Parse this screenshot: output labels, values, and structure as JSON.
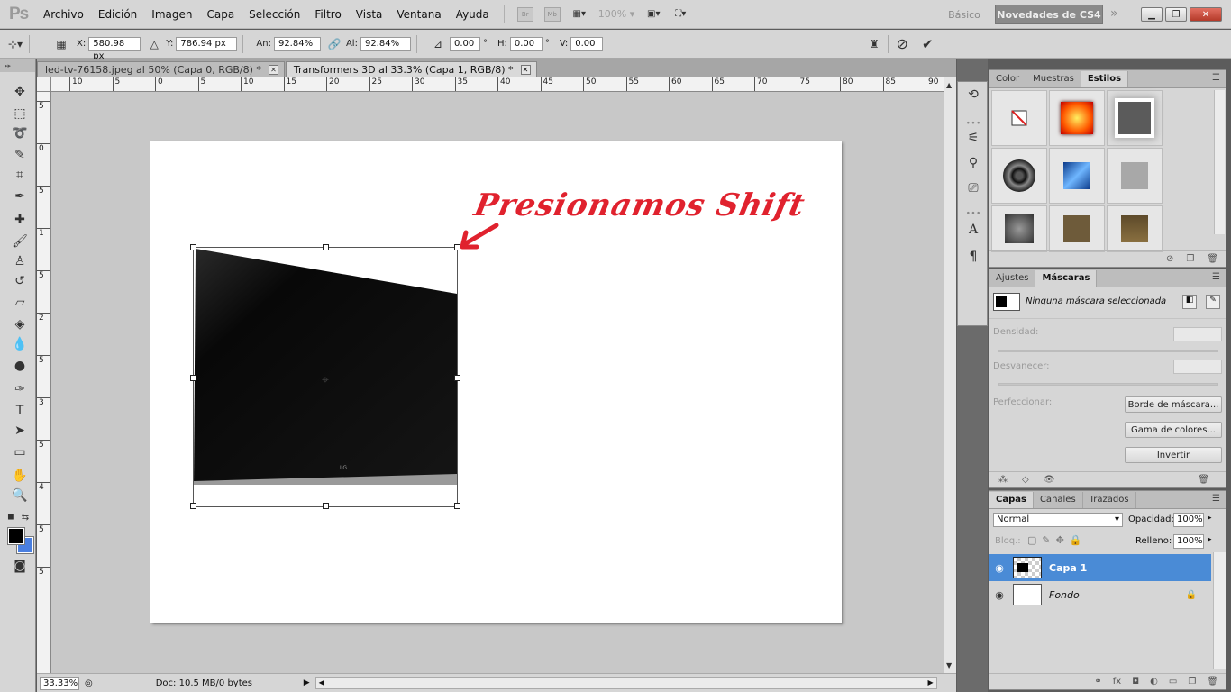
{
  "app": {
    "logo": "Ps",
    "menu": [
      "Archivo",
      "Edición",
      "Imagen",
      "Capa",
      "Selección",
      "Filtro",
      "Vista",
      "Ventana",
      "Ayuda"
    ],
    "bridge_label": "Br",
    "minibridge_label": "Mb",
    "zoom_level": "100%",
    "workspace_basic": "Básico",
    "workspace_cs4": "Novedades de CS4",
    "workspace_more": "»"
  },
  "options": {
    "x_label": "X:",
    "x_value": "580.98 px",
    "y_label": "Y:",
    "y_value": "786.94 px",
    "width_label": "An:",
    "width_value": "92.84%",
    "height_label": "Al:",
    "height_value": "92.84%",
    "angle_value": "0.00",
    "angle_unit": "°",
    "h_skew_label": "H:",
    "h_skew_value": "0.00",
    "h_skew_unit": "°",
    "v_skew_label": "V:",
    "v_skew_value": "0.00"
  },
  "tabs": [
    {
      "label": "led-tv-76158.jpeg al 50% (Capa 0, RGB/8) *",
      "active": false
    },
    {
      "label": "Transformers 3D al 33.3% (Capa 1, RGB/8) *",
      "active": true
    }
  ],
  "ruler_h": [
    "10",
    "5",
    "0",
    "5",
    "10",
    "15",
    "20",
    "25",
    "30",
    "35",
    "40",
    "45",
    "50",
    "55",
    "60",
    "65",
    "70",
    "75",
    "80",
    "85",
    "90"
  ],
  "ruler_v": [
    "5",
    "0",
    "5",
    "1",
    "5",
    "2",
    "5",
    "3",
    "5",
    "4",
    "5",
    "5"
  ],
  "canvas": {
    "annotation": "Presionamos Shift",
    "tv_brand": "LG"
  },
  "status": {
    "zoom": "33.33%",
    "doc_info": "Doc: 10.5 MB/0 bytes"
  },
  "styles_panel": {
    "tabs": [
      "Color",
      "Muestras",
      "Estilos"
    ],
    "active_tab": "Estilos"
  },
  "masks_panel": {
    "tabs": [
      "Ajustes",
      "Máscaras"
    ],
    "active_tab": "Máscaras",
    "no_mask": "Ninguna máscara seleccionada",
    "density_label": "Densidad:",
    "feather_label": "Desvanecer:",
    "refine_label": "Perfeccionar:",
    "mask_edge_button": "Borde de máscara...",
    "color_range_button": "Gama de colores...",
    "invert_button": "Invertir"
  },
  "layers_panel": {
    "tabs": [
      "Capas",
      "Canales",
      "Trazados"
    ],
    "active_tab": "Capas",
    "blend_mode": "Normal",
    "opacity_label": "Opacidad:",
    "opacity_value": "100%",
    "lock_label": "Bloq.:",
    "fill_label": "Relleno:",
    "fill_value": "100%",
    "layers": [
      {
        "name": "Capa 1",
        "selected": true
      },
      {
        "name": "Fondo",
        "selected": false
      }
    ]
  },
  "colors": {
    "foreground": "#000000",
    "background": "#4a7fe0",
    "annotation": "#e0222e",
    "layer_selected": "#4a8bd6"
  }
}
